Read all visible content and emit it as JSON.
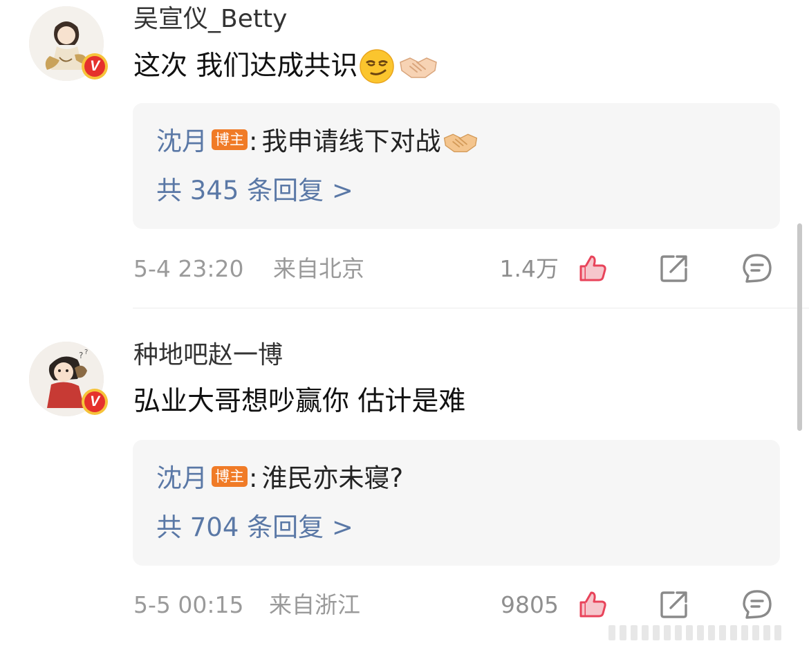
{
  "comments": [
    {
      "username": "吴宣仪_Betty",
      "text": "这次 我们达成共识",
      "emojis": [
        "smirk-face-emoji",
        "handshake-emoji"
      ],
      "reply": {
        "author": "沈月",
        "badge": "博主",
        "colon": ":",
        "text": "我申请线下对战",
        "emoji": "handshake-emoji",
        "count_label": "共 345 条回复 >"
      },
      "time": "5-4 23:20",
      "location": "来自北京",
      "likes": "1.4万"
    },
    {
      "username": "种地吧赵一博",
      "text": "弘业大哥想吵赢你 估计是难",
      "reply": {
        "author": "沈月",
        "badge": "博主",
        "colon": ":",
        "text": "淮民亦未寝?",
        "count_label": "共 704 条回复 >"
      },
      "time": "5-5 00:15",
      "location": "来自浙江",
      "likes": "9805"
    }
  ],
  "badge_letter": "V",
  "colors": {
    "like_icon": "#e8435a",
    "link_blue": "#5a78a6",
    "host_badge": "#f07b27",
    "verified_red": "#e5312c",
    "verified_gold": "#f6c33a",
    "meta_gray": "#9a9a9a"
  }
}
